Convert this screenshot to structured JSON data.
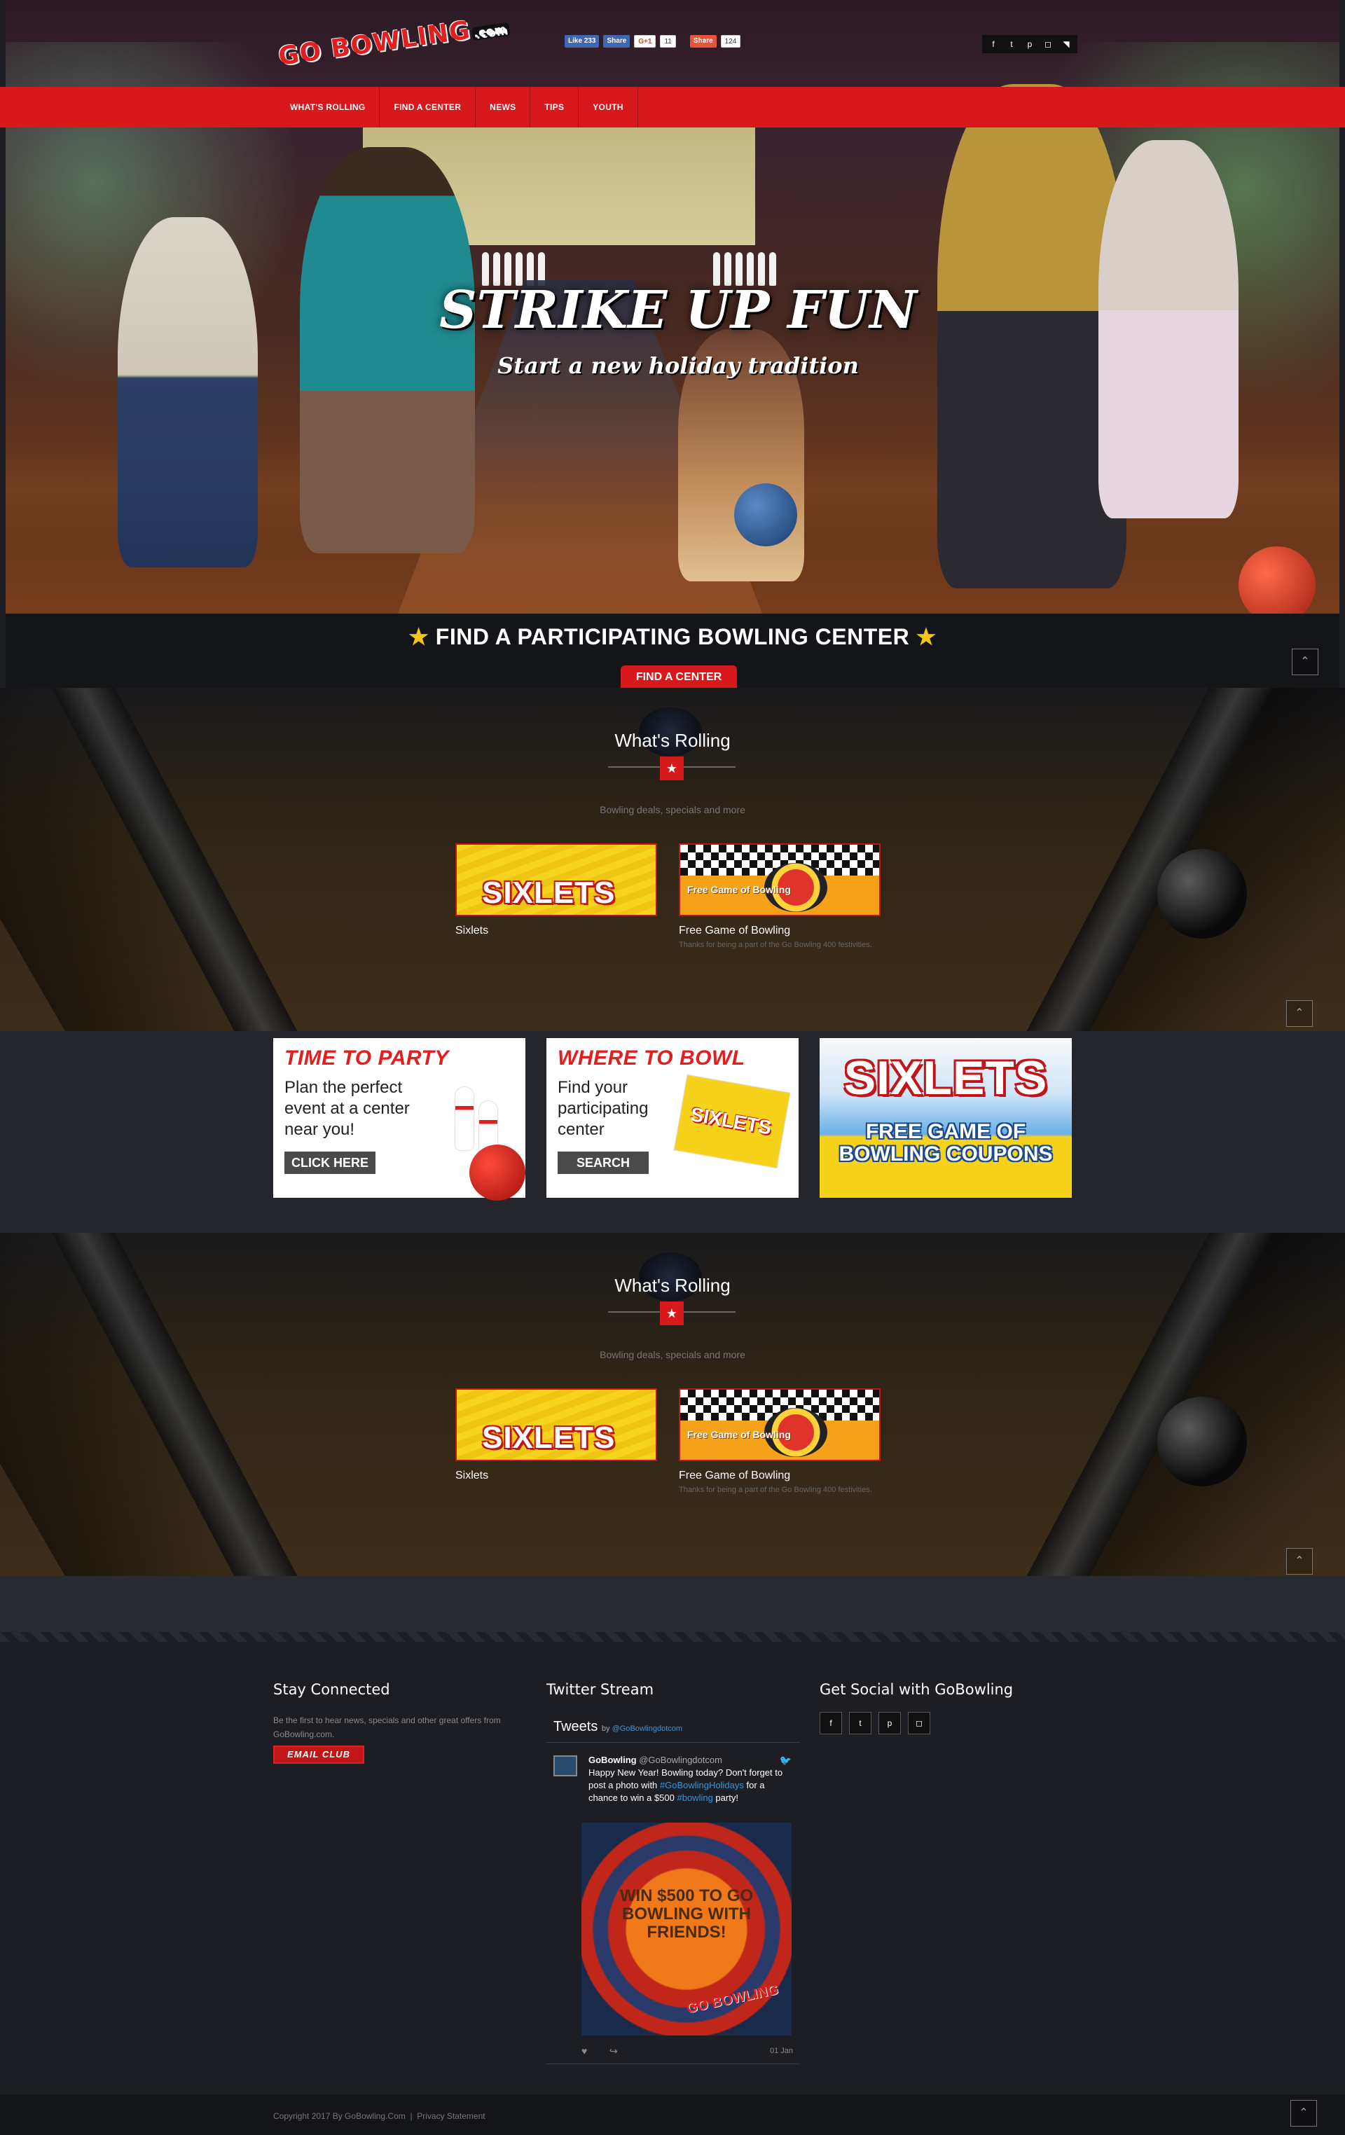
{
  "brand": {
    "logo_text": "GO BOWLING",
    "logo_suffix": ".com"
  },
  "share": {
    "like_label": "Like 233",
    "share_label": "Share",
    "gplus_label": "G+1",
    "gplus_count": "11",
    "share2_label": "Share",
    "share2_count": "124"
  },
  "nav": {
    "items": [
      "WHAT'S ROLLING",
      "FIND A CENTER",
      "NEWS",
      "TIPS",
      "YOUTH"
    ]
  },
  "hero": {
    "title": "STRIKE UP FUN",
    "subtitle": "Start a new holiday tradition"
  },
  "find": {
    "heading": "FIND A PARTICIPATING BOWLING CENTER",
    "star": "★",
    "button": "FIND A CENTER",
    "up_glyph": "⌃"
  },
  "rolling": {
    "title": "What's Rolling",
    "tagline": "Bowling deals, specials and more",
    "star": "★",
    "cards": [
      {
        "image_text": "SIXLETS",
        "title": "Sixlets",
        "desc": ""
      },
      {
        "image_text": "Free Game of Bowling",
        "title": "Free Game of Bowling",
        "desc": "Thanks for being a part of the Go Bowling 400 festivities."
      }
    ]
  },
  "promo": {
    "party": {
      "title": "TIME TO PARTY",
      "text": "Plan the perfect event at a center near you!",
      "button": "CLICK HERE"
    },
    "where": {
      "title": "WHERE TO BOWL",
      "text": "Find your participating center",
      "button": "SEARCH",
      "mini": "SIXLETS"
    },
    "coupons": {
      "big": "SIXLETS",
      "small": "FREE GAME OF BOWLING COUPONS"
    }
  },
  "footer": {
    "stay": {
      "title": "Stay Connected",
      "text": "Be the first to hear news, specials and other great offers from GoBowling.com.",
      "button": "EMAIL CLUB"
    },
    "twitter": {
      "title": "Twitter Stream",
      "head": "Tweets",
      "by": "by",
      "by_handle": "@GoBowlingdotcom",
      "user": "GoBowling",
      "handle": "@GoBowlingdotcom",
      "text_a": "Happy New Year! Bowling today? Don't forget to post a photo with ",
      "hashtag1": "#GoBowlingHolidays",
      "text_b": " for a chance to win a $500 ",
      "hashtag2": "#bowling",
      "text_c": " party!",
      "photo_text": "WIN $500 TO GO BOWLING WITH FRIENDS!",
      "photo_logo": "GO BOWLING",
      "date": "01 Jan"
    },
    "social": {
      "title": "Get Social with GoBowling"
    }
  },
  "copyright": {
    "text": "Copyright 2017 By GoBowling.Com",
    "sep": "|",
    "privacy": "Privacy Statement"
  }
}
